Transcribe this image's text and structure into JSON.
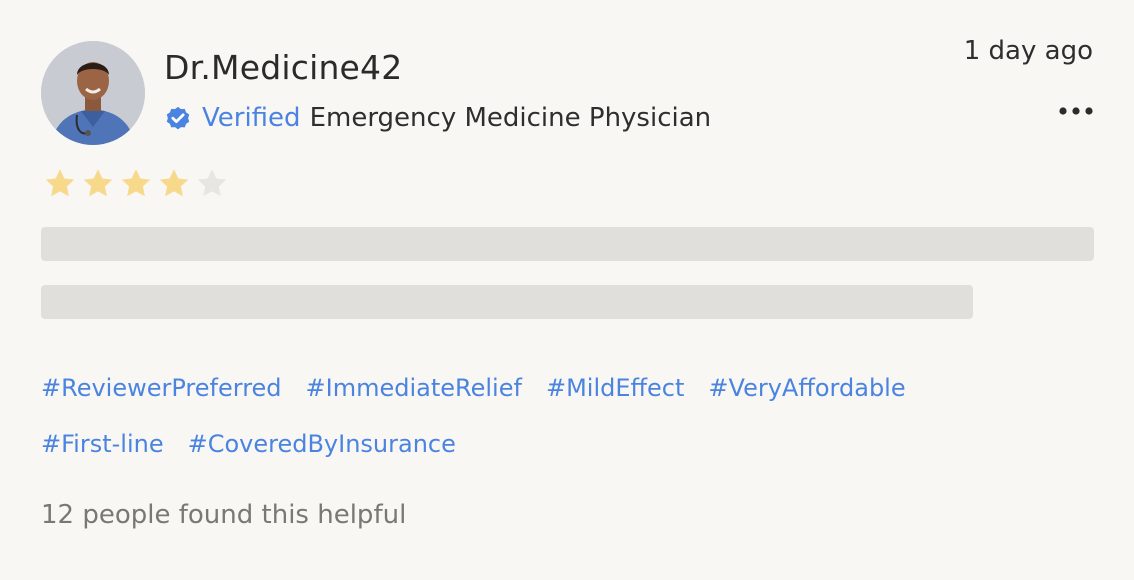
{
  "review": {
    "username": "Dr.Medicine42",
    "verified_label": "Verified",
    "specialty": "Emergency Medicine Physician",
    "timestamp": "1 day ago",
    "rating": 4,
    "rating_max": 5,
    "tags_row1": [
      "#ReviewerPreferred",
      "#ImmediateRelief",
      "#MildEffect",
      "#VeryAffordable"
    ],
    "tags_row2": [
      "#First-line",
      "#CoveredByInsurance"
    ],
    "helpful_text": "12 people found this helpful"
  },
  "icons": {
    "avatar": "user-avatar",
    "verified": "verified-badge-icon",
    "more": "more-options-icon",
    "star": "star-icon"
  },
  "colors": {
    "accent": "#4a84e0",
    "star_filled": "#f7d98b",
    "star_empty": "#e8e6e3",
    "skeleton": "#e0dfdb",
    "background": "#f9f7f3"
  }
}
